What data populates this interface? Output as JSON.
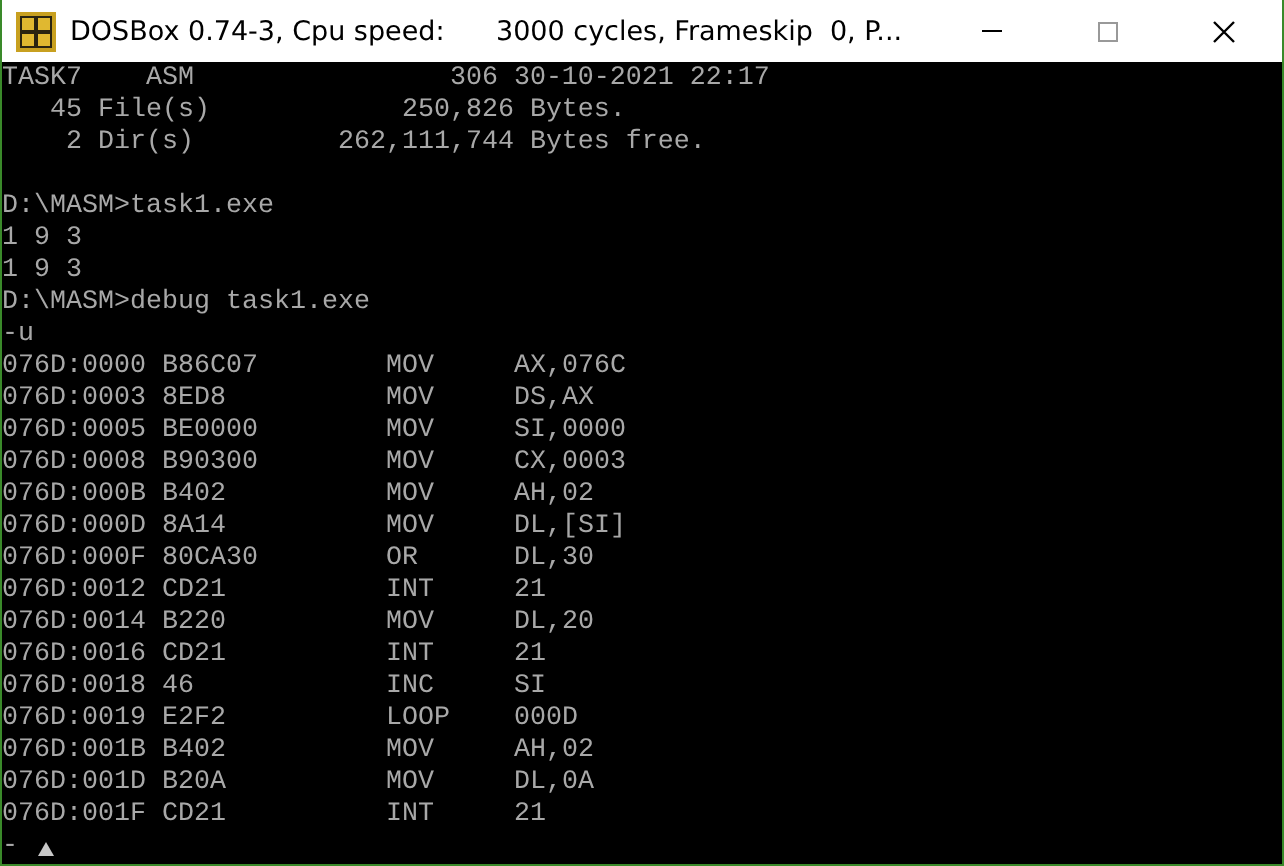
{
  "window": {
    "title": "DOSBox 0.74-3, Cpu speed:      3000 cycles, Frameskip  0, P..."
  },
  "console": [
    {
      "kind": "text",
      "text": "TASK7    ASM                306 30-10-2021 22:17"
    },
    {
      "kind": "text",
      "text": "   45 File(s)            250,826 Bytes."
    },
    {
      "kind": "text",
      "text": "    2 Dir(s)         262,111,744 Bytes free."
    },
    {
      "kind": "blank"
    },
    {
      "kind": "text",
      "text": "D:\\MASM>task1.exe"
    },
    {
      "kind": "text",
      "text": "1 9 3"
    },
    {
      "kind": "text",
      "text": "1 9 3"
    },
    {
      "kind": "text",
      "text": "D:\\MASM>debug task1.exe"
    },
    {
      "kind": "text",
      "text": "-u"
    },
    {
      "kind": "disasm",
      "address": "076D:0000",
      "bytes": "B86C07",
      "mnemonic": "MOV",
      "operands": "AX,076C"
    },
    {
      "kind": "disasm",
      "address": "076D:0003",
      "bytes": "8ED8",
      "mnemonic": "MOV",
      "operands": "DS,AX"
    },
    {
      "kind": "disasm",
      "address": "076D:0005",
      "bytes": "BE0000",
      "mnemonic": "MOV",
      "operands": "SI,0000"
    },
    {
      "kind": "disasm",
      "address": "076D:0008",
      "bytes": "B90300",
      "mnemonic": "MOV",
      "operands": "CX,0003"
    },
    {
      "kind": "disasm",
      "address": "076D:000B",
      "bytes": "B402",
      "mnemonic": "MOV",
      "operands": "AH,02"
    },
    {
      "kind": "disasm",
      "address": "076D:000D",
      "bytes": "8A14",
      "mnemonic": "MOV",
      "operands": "DL,[SI]"
    },
    {
      "kind": "disasm",
      "address": "076D:000F",
      "bytes": "80CA30",
      "mnemonic": "OR",
      "operands": "DL,30"
    },
    {
      "kind": "disasm",
      "address": "076D:0012",
      "bytes": "CD21",
      "mnemonic": "INT",
      "operands": "21"
    },
    {
      "kind": "disasm",
      "address": "076D:0014",
      "bytes": "B220",
      "mnemonic": "MOV",
      "operands": "DL,20"
    },
    {
      "kind": "disasm",
      "address": "076D:0016",
      "bytes": "CD21",
      "mnemonic": "INT",
      "operands": "21"
    },
    {
      "kind": "disasm",
      "address": "076D:0018",
      "bytes": "46",
      "mnemonic": "INC",
      "operands": "SI"
    },
    {
      "kind": "disasm",
      "address": "076D:0019",
      "bytes": "E2F2",
      "mnemonic": "LOOP",
      "operands": "000D"
    },
    {
      "kind": "disasm",
      "address": "076D:001B",
      "bytes": "B402",
      "mnemonic": "MOV",
      "operands": "AH,02"
    },
    {
      "kind": "disasm",
      "address": "076D:001D",
      "bytes": "B20A",
      "mnemonic": "MOV",
      "operands": "DL,0A"
    },
    {
      "kind": "disasm",
      "address": "076D:001F",
      "bytes": "CD21",
      "mnemonic": "INT",
      "operands": "21"
    },
    {
      "kind": "prompt",
      "text": "-"
    }
  ]
}
